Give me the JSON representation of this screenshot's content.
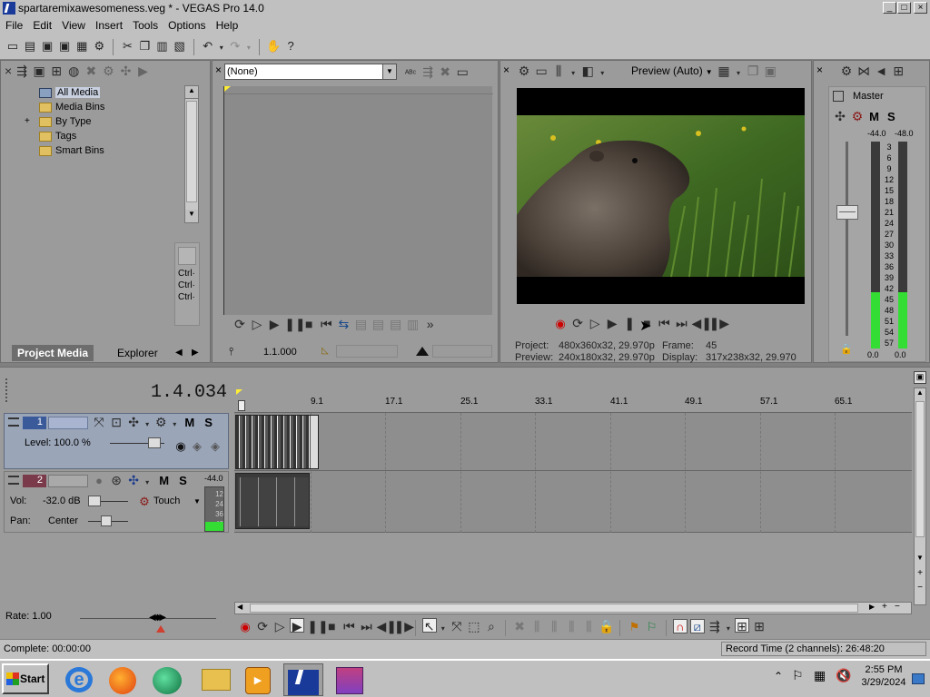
{
  "window": {
    "title": "spartaremixawesomeness.veg * - VEGAS Pro 14.0",
    "controls": [
      "_",
      "□",
      "×"
    ]
  },
  "menu": [
    "File",
    "Edit",
    "View",
    "Insert",
    "Tools",
    "Options",
    "Help"
  ],
  "project_media": {
    "tree": [
      "All Media",
      "Media Bins",
      "By Type",
      "Tags",
      "Smart Bins"
    ],
    "tree_expander": "+",
    "side_labels": [
      "Ctrl·",
      "Ctrl·",
      "Ctrl·"
    ],
    "tabs": [
      "Project Media",
      "Explorer"
    ]
  },
  "trimmer": {
    "dropdown_value": "(None)",
    "timecode": "1.1.000"
  },
  "preview": {
    "mode": "Preview (Auto)",
    "project_label": "Project:",
    "project_value": "480x360x32, 29.970p",
    "preview_label": "Preview:",
    "preview_value": "240x180x32, 29.970p",
    "frame_label": "Frame:",
    "frame_value": "45",
    "display_label": "Display:",
    "display_value": "317x238x32, 29.970"
  },
  "master": {
    "label": "Master",
    "m": "M",
    "s": "S",
    "left_peak": "-44.0",
    "right_peak": "-48.0",
    "scale": [
      "3",
      "6",
      "9",
      "12",
      "15",
      "18",
      "21",
      "24",
      "27",
      "30",
      "33",
      "36",
      "39",
      "42",
      "45",
      "48",
      "51",
      "54",
      "57"
    ],
    "left_val": "0.0",
    "right_val": "0.0",
    "left_level": 0.27,
    "right_level": 0.27
  },
  "timeline": {
    "position": "1.4.034",
    "ruler": [
      "9.1",
      "17.1",
      "25.1",
      "33.1",
      "41.1",
      "49.1",
      "57.1",
      "65.1"
    ],
    "video_track": {
      "number": "1",
      "level_label": "Level: 100.0 %",
      "m": "M",
      "s": "S"
    },
    "audio_track": {
      "number": "2",
      "m": "M",
      "s": "S",
      "vol_label": "Vol:",
      "vol_value": "-32.0 dB",
      "pan_label": "Pan:",
      "pan_value": "Center",
      "automation": "Touch",
      "meter_peak": "-44.0",
      "meter_scale": [
        "12",
        "24",
        "36",
        "48"
      ]
    },
    "rate": "Rate: 1.00"
  },
  "status": {
    "left": "Complete: 00:00:00",
    "right": "Record Time (2 channels): 26:48:20"
  },
  "taskbar": {
    "start": "Start",
    "time": "2:55 PM",
    "date": "3/29/2024"
  },
  "colors": {
    "panel": "#9b9b9b",
    "track_video": "#9aa5b8",
    "meter_green": "#33dd33",
    "taskbar": "#c0c0c0"
  }
}
